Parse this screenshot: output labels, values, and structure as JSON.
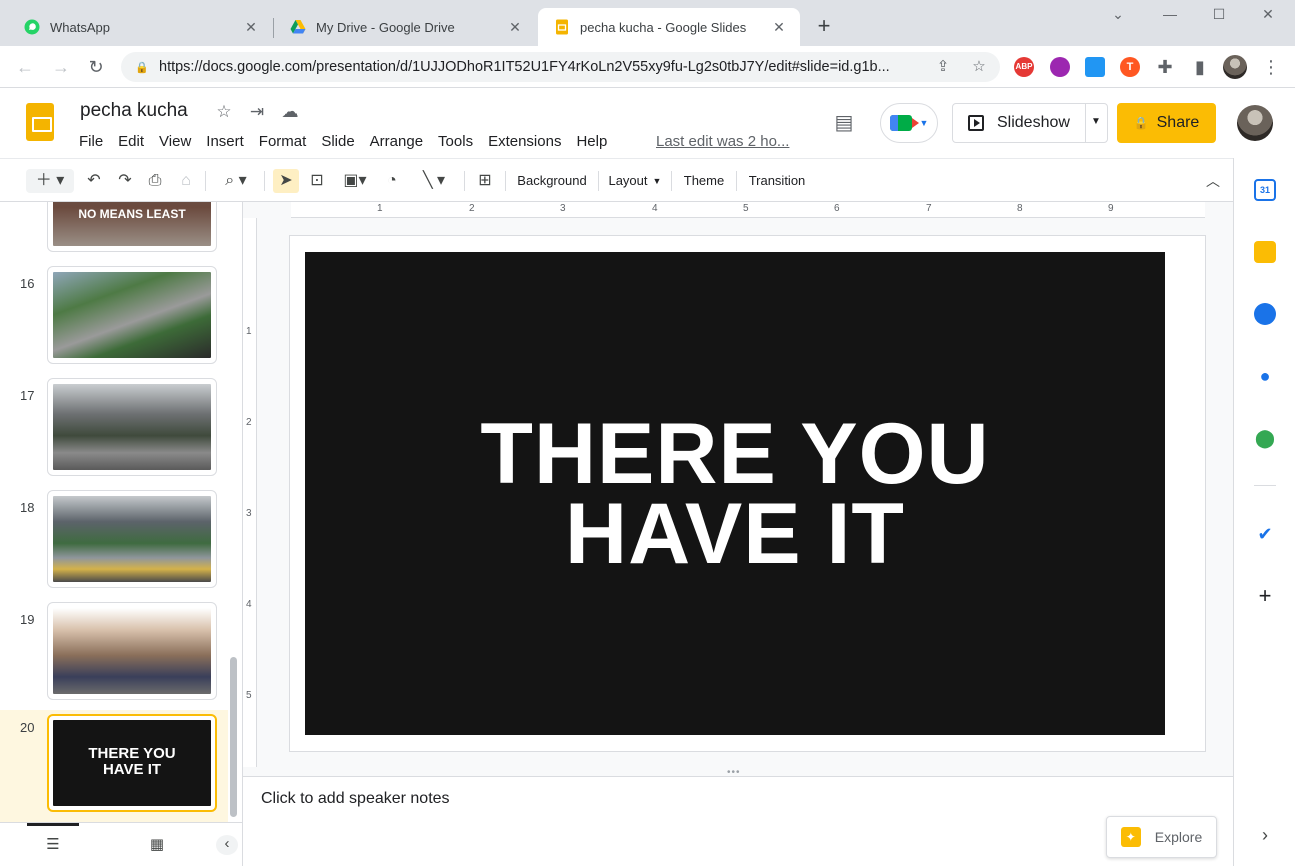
{
  "browser": {
    "tabs": [
      {
        "title": "WhatsApp",
        "icon": "whatsapp-icon"
      },
      {
        "title": "My Drive - Google Drive",
        "icon": "google-drive-icon"
      },
      {
        "title": "pecha kucha - Google Slides",
        "icon": "google-slides-icon"
      }
    ],
    "new_tab": "+",
    "url": "https://docs.google.com/presentation/d/1UJJODhoR1IT52U1FY4rKoLn2V55xy9fu-Lg2s0tbJ7Y/edit#slide=id.g1b...",
    "extensions": [
      {
        "name": "adblock-plus-icon",
        "label": "ABP",
        "color": "#e53935"
      },
      {
        "name": "extension-purple-icon",
        "label": "",
        "color": "#9c27b0"
      },
      {
        "name": "mail-extension-icon",
        "label": "",
        "color": "#2196f3"
      },
      {
        "name": "extension-orange-icon",
        "label": "T",
        "color": "#ff5722"
      }
    ]
  },
  "app": {
    "title": "pecha kucha",
    "menu": [
      "File",
      "Edit",
      "View",
      "Insert",
      "Format",
      "Slide",
      "Arrange",
      "Tools",
      "Extensions",
      "Help"
    ],
    "last_edit": "Last edit was 2 ho...",
    "slideshow_label": "Slideshow",
    "share_label": "Share",
    "accent": "#fbbc04"
  },
  "toolbar": {
    "background": "Background",
    "layout": "Layout",
    "theme": "Theme",
    "transition": "Transition"
  },
  "filmstrip": {
    "slides": [
      {
        "number": "",
        "thumb_text": "NO MEANS LEAST"
      },
      {
        "number": "16",
        "thumb_text": ""
      },
      {
        "number": "17",
        "thumb_text": ""
      },
      {
        "number": "18",
        "thumb_text": ""
      },
      {
        "number": "19",
        "thumb_text": ""
      },
      {
        "number": "20",
        "thumb_text_line1": "THERE YOU",
        "thumb_text_line2": "HAVE IT"
      }
    ]
  },
  "ruler": {
    "h": [
      "1",
      "2",
      "3",
      "4",
      "5",
      "6",
      "7",
      "8",
      "9"
    ],
    "v": [
      "1",
      "2",
      "3",
      "4",
      "5"
    ]
  },
  "slide": {
    "line1": "THERE YOU",
    "line2": "HAVE IT",
    "background_color": "#141414",
    "text_color": "#ffffff"
  },
  "notes": {
    "placeholder": "Click to add speaker notes"
  },
  "explore_label": "Explore",
  "side_panel": [
    {
      "name": "google-calendar-icon",
      "label": "31",
      "color": "#1a73e8"
    },
    {
      "name": "google-keep-icon",
      "label": "",
      "color": "#fbbc04"
    },
    {
      "name": "google-tasks-icon",
      "label": "",
      "color": "#1a73e8"
    },
    {
      "name": "google-contacts-icon",
      "label": "",
      "color": "#1a73e8"
    },
    {
      "name": "google-maps-icon",
      "label": "",
      "color": "#34a853"
    }
  ]
}
